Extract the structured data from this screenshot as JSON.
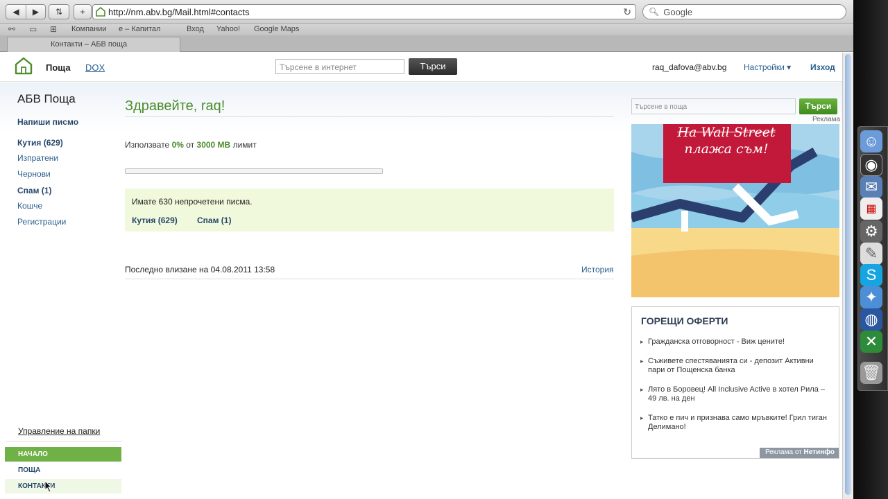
{
  "browser": {
    "url": "http://nm.abv.bg/Mail.html#contacts",
    "search_placeholder": "Google",
    "bookmarks": [
      "Компании",
      "е – Капитал",
      "Вход",
      "Yahoo!",
      "Google Maps"
    ],
    "tab_title": "Контакти – АБВ поща"
  },
  "header": {
    "nav_mail": "Поща",
    "nav_dox": "DOX",
    "internet_search_placeholder": "Търсене в интернет",
    "internet_search_button": "Търси",
    "user_email": "raq_dafova@abv.bg",
    "settings": "Настройки ▾",
    "logout": "Изход"
  },
  "sidebar": {
    "brand": "АБВ Поща",
    "compose": "Напиши писмо",
    "folders": [
      {
        "label": "Кутия (629)",
        "bold": true
      },
      {
        "label": "Изпратени",
        "bold": false
      },
      {
        "label": "Чернови",
        "bold": false
      },
      {
        "label": "Спам (1)",
        "bold": true
      },
      {
        "label": "Кошче",
        "bold": false
      },
      {
        "label": "Регистрации",
        "bold": false
      }
    ],
    "manage_folders": "Управление на папки",
    "tabs": {
      "home": "НАЧАЛО",
      "mail": "ПОЩА",
      "contacts": "КОНТАКТИ"
    }
  },
  "main": {
    "greeting": "Здравейте, raq!",
    "usage_prefix": "Използвате",
    "usage_percent": "0%",
    "usage_mid": "от",
    "usage_limit": "3000 MB",
    "usage_suffix": "лимит",
    "quota_fraction": 0.0,
    "unread_text": "Имате 630 непрочетени писма.",
    "unread_inbox": "Кутия (629)",
    "unread_spam": "Спам (1)",
    "last_login": "Последно влизане на 04.08.2011 13:58",
    "history": "История"
  },
  "right": {
    "mail_search_placeholder": "Търсене в поща",
    "mail_search_button": "Търси",
    "ad_label": "Реклама",
    "ad_text_line1": "На Wall Street",
    "ad_text_line2": "плажа съм!",
    "offers_title": "ГОРЕЩИ ОФЕРТИ",
    "offers": [
      "Гражданска отговорност - Виж цените!",
      "Съживете спестяванията си - депозит Активни пари от Пощенска банка",
      "Лято в Боровец! All Inclusive Active в хотел Рила – 49 лв. на ден",
      "Татко е пич и признава само мръвките! Грил тиган Делимано!"
    ],
    "offers_footer_prefix": "Реклама от",
    "offers_footer_brand": "Нетинфо"
  },
  "colors": {
    "accent_green": "#6fb146",
    "link_blue": "#2a5e8e",
    "unread_bg": "#f0f9db"
  }
}
